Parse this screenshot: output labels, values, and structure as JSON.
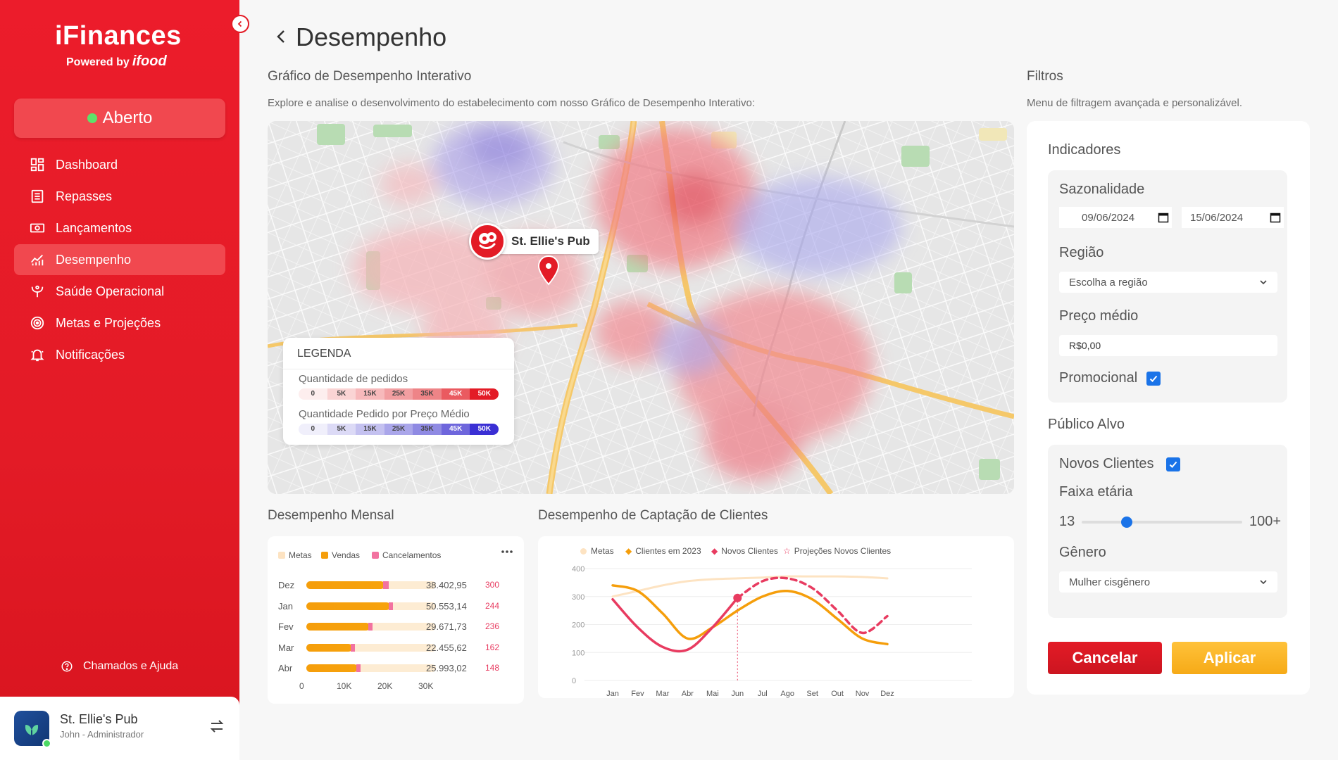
{
  "app": {
    "brand": "iFinances",
    "powered_by": "Powered by",
    "partner": "ifood"
  },
  "status": {
    "label": "Aberto",
    "color": "#5ee16a"
  },
  "nav": [
    {
      "label": "Dashboard",
      "icon": "dashboard-icon"
    },
    {
      "label": "Repasses",
      "icon": "list-icon"
    },
    {
      "label": "Lançamentos",
      "icon": "cash-icon"
    },
    {
      "label": "Desempenho",
      "icon": "chart-icon",
      "active": true
    },
    {
      "label": "Saúde Operacional",
      "icon": "health-icon"
    },
    {
      "label": "Metas e Projeções",
      "icon": "target-icon"
    },
    {
      "label": "Notificações",
      "icon": "bell-icon"
    }
  ],
  "help_label": "Chamados e Ajuda",
  "account": {
    "name": "St. Ellie's Pub",
    "role": "John - Administrador"
  },
  "page_title": "Desempenho",
  "map_section": {
    "title": "Gráfico de Desempenho Interativo",
    "description": "Explore e analise o desenvolvimento do estabelecimento com nosso Gráfico de Desempenho Interativo:",
    "pin_label": "St. Ellie's Pub",
    "legend": {
      "title": "LEGENDA",
      "orders_label": "Quantidade de pedidos",
      "price_label": "Quantidade Pedido por Preço Médio",
      "steps": [
        "0",
        "5K",
        "15K",
        "25K",
        "35K",
        "45K",
        "50K"
      ],
      "orders_colors": [
        "#fdeeee",
        "#fad4d4",
        "#f7b9bb",
        "#f29ea1",
        "#ee8487",
        "#ea5a60",
        "#e31b26"
      ],
      "price_colors": [
        "#f0effb",
        "#dcdaf6",
        "#c4c1f0",
        "#aaa6ea",
        "#8f8ae3",
        "#6e66dc",
        "#3a2fd4"
      ]
    }
  },
  "filters": {
    "title": "Filtros",
    "description": "Menu de filtragem avançada e personalizável.",
    "indicators_title": "Indicadores",
    "seasonality_label": "Sazonalidade",
    "date_from": "09/06/2024",
    "date_to": "15/06/2024",
    "region_label": "Região",
    "region_placeholder": "Escolha a região",
    "avg_price_label": "Preço médio",
    "avg_price_value": "R$0,00",
    "promo_label": "Promocional",
    "promo_checked": true,
    "audience_title": "Público Alvo",
    "new_clients_label": "Novos Clientes",
    "new_clients_checked": true,
    "age_label": "Faixa etária",
    "age_min": "13",
    "age_max": "100+",
    "age_value": 0.28,
    "gender_label": "Gênero",
    "gender_value": "Mulher cisgênero",
    "cancel_label": "Cancelar",
    "apply_label": "Aplicar"
  },
  "monthly": {
    "title": "Desempenho Mensal",
    "legend": [
      {
        "label": "Metas",
        "color": "#fde3c2"
      },
      {
        "label": "Vendas",
        "color": "#f59e0b"
      },
      {
        "label": "Cancelamentos",
        "color": "#f272a0"
      }
    ],
    "rows": [
      {
        "month": "Dez",
        "value": "38.402,95",
        "count": "300"
      },
      {
        "month": "Jan",
        "value": "50.553,14",
        "count": "244"
      },
      {
        "month": "Fev",
        "value": "29.671,73",
        "count": "236"
      },
      {
        "month": "Mar",
        "value": "22.455,62",
        "count": "162"
      },
      {
        "month": "Abr",
        "value": "25.993,02",
        "count": "148"
      }
    ],
    "axis": [
      "0",
      "10K",
      "20K",
      "30K"
    ]
  },
  "capture": {
    "title": "Desempenho de Captação de Clientes",
    "legend": [
      {
        "label": "Metas",
        "color": "#fde3c2"
      },
      {
        "label": "Clientes em 2023",
        "color": "#f59e0b"
      },
      {
        "label": "Novos Clientes",
        "color": "#e83b60"
      },
      {
        "label": "Projeções Novos Clientes",
        "color": "#e83b60"
      }
    ]
  },
  "chart_data": [
    {
      "type": "bar",
      "categories": [
        "Dez",
        "Jan",
        "Fev",
        "Mar",
        "Abr"
      ],
      "series": [
        {
          "name": "Metas",
          "values": [
            38000,
            38000,
            38000,
            38000,
            38000
          ]
        },
        {
          "name": "Vendas",
          "values": [
            23000,
            24500,
            18500,
            13500,
            15000
          ]
        },
        {
          "name": "Cancelamentos",
          "values": [
            1500,
            1300,
            1200,
            800,
            700
          ]
        }
      ],
      "data_labels": [
        "38.402,95",
        "50.553,14",
        "29.671,73",
        "22.455,62",
        "25.993,02"
      ],
      "count_labels": [
        "300",
        "244",
        "236",
        "162",
        "148"
      ],
      "xlim": [
        0,
        38000
      ],
      "xticks": [
        "0",
        "10K",
        "20K",
        "30K"
      ],
      "legend_position": "top-left",
      "grid": false
    },
    {
      "type": "line",
      "categories": [
        "Jan",
        "Fev",
        "Mar",
        "Abr",
        "Mai",
        "Jun",
        "Jul",
        "Ago",
        "Set",
        "Out",
        "Nov",
        "Dez"
      ],
      "series": [
        {
          "name": "Metas",
          "values": [
            300,
            320,
            340,
            355,
            362,
            365,
            368,
            372,
            372,
            372,
            370,
            365
          ]
        },
        {
          "name": "Clientes em 2023",
          "values": [
            340,
            320,
            240,
            150,
            190,
            250,
            300,
            320,
            290,
            220,
            150,
            130
          ]
        },
        {
          "name": "Novos Clientes",
          "values": [
            290,
            190,
            120,
            110,
            190,
            295,
            null,
            null,
            null,
            null,
            null,
            null
          ]
        },
        {
          "name": "Projeções Novos Clientes",
          "values": [
            null,
            null,
            null,
            null,
            null,
            295,
            355,
            365,
            330,
            250,
            170,
            230
          ]
        }
      ],
      "yticks": [
        0,
        100,
        200,
        300,
        400
      ],
      "ylim": [
        0,
        400
      ],
      "legend_position": "top-left",
      "grid": true
    }
  ]
}
